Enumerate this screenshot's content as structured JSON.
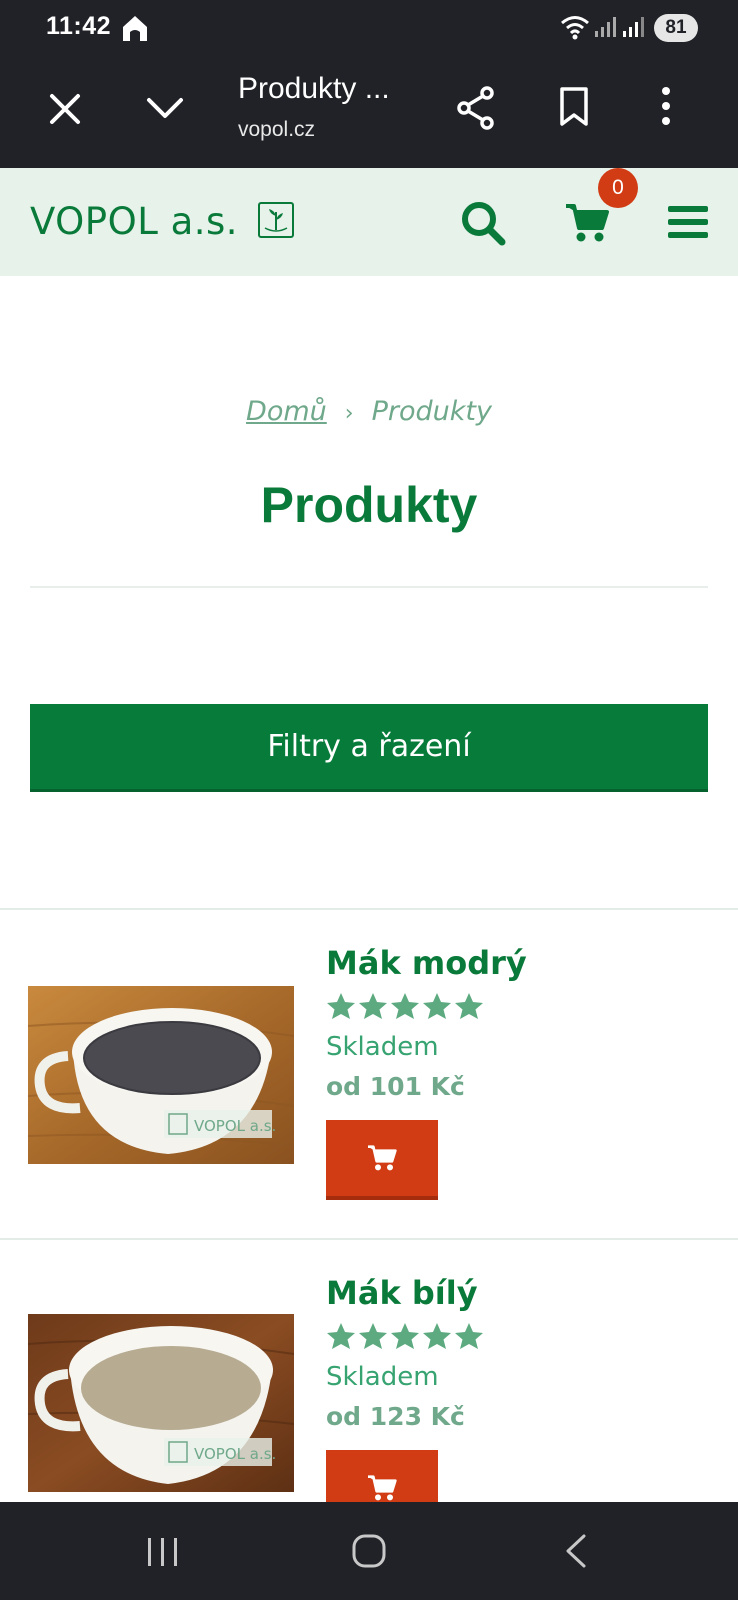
{
  "status_bar": {
    "time": "11:42",
    "battery": "81"
  },
  "browser": {
    "page_title": "Produkty ...",
    "url": "vopol.cz"
  },
  "header": {
    "logo_text": "VOPOL a.s.",
    "cart_count": "0",
    "accent_color": "#0a7a3a",
    "badge_color": "#d13c14"
  },
  "breadcrumb": {
    "home": "Domů",
    "separator": "›",
    "current": "Produkty"
  },
  "page": {
    "title": "Produkty",
    "filter_button": "Filtry a řazení"
  },
  "products": [
    {
      "name": "Mák modrý",
      "rating": 5,
      "stock": "Skladem",
      "price": "od 101 Kč",
      "image_watermark": "VOPOL a.s."
    },
    {
      "name": "Mák bílý",
      "rating": 5,
      "stock": "Skladem",
      "price": "od 123 Kč",
      "image_watermark": "VOPOL a.s."
    }
  ]
}
